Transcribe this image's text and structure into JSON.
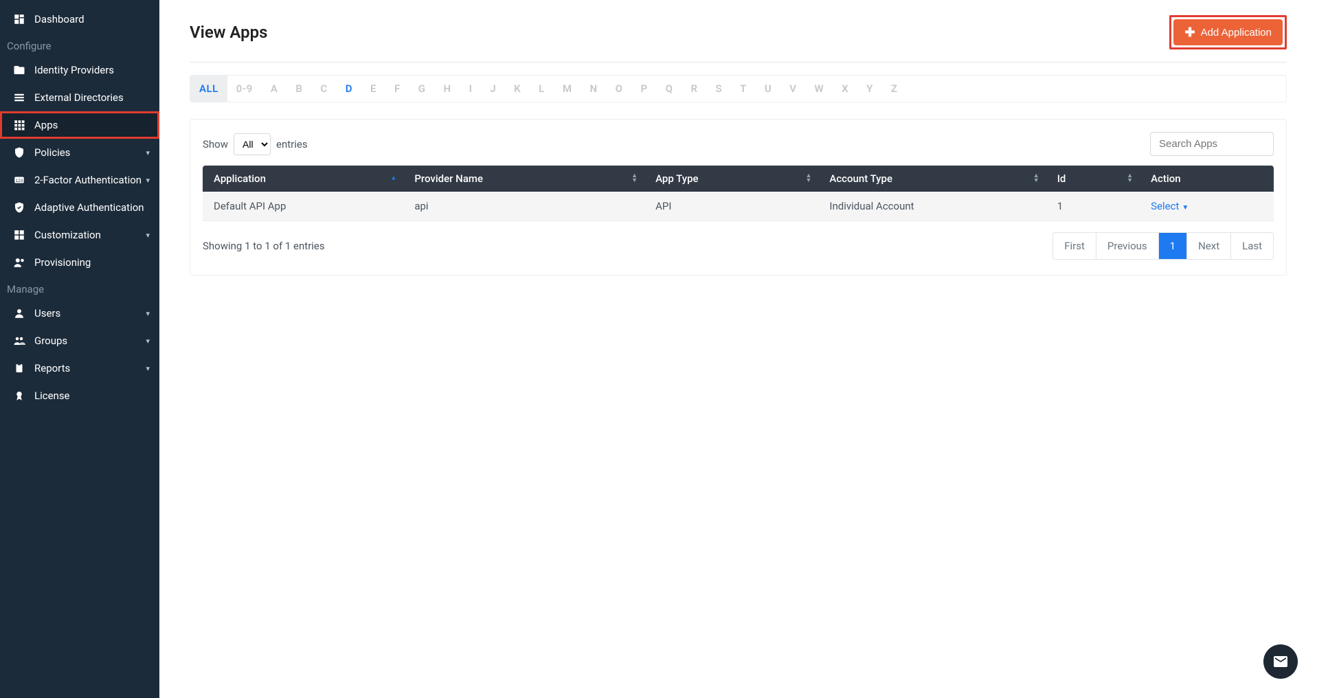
{
  "sidebar": {
    "items": [
      {
        "label": "Dashboard",
        "icon": "dashboard-icon",
        "chev": false
      },
      {
        "section": "Configure"
      },
      {
        "label": "Identity Providers",
        "icon": "idp-icon",
        "chev": false
      },
      {
        "label": "External Directories",
        "icon": "list-icon",
        "chev": false
      },
      {
        "label": "Apps",
        "icon": "grid-icon",
        "chev": false,
        "active": true,
        "highlight": true
      },
      {
        "label": "Policies",
        "icon": "shield-icon",
        "chev": true
      },
      {
        "label": "2-Factor Authentication",
        "icon": "numbers-icon",
        "chev": true
      },
      {
        "label": "Adaptive Authentication",
        "icon": "check-shield-icon",
        "chev": false
      },
      {
        "label": "Customization",
        "icon": "puzzle-icon",
        "chev": true
      },
      {
        "label": "Provisioning",
        "icon": "users-cog-icon",
        "chev": false
      },
      {
        "section": "Manage"
      },
      {
        "label": "Users",
        "icon": "user-icon",
        "chev": true
      },
      {
        "label": "Groups",
        "icon": "group-icon",
        "chev": true
      },
      {
        "label": "Reports",
        "icon": "clipboard-icon",
        "chev": true
      },
      {
        "label": "License",
        "icon": "ribbon-icon",
        "chev": false
      }
    ]
  },
  "header": {
    "title": "View Apps",
    "add_label": "Add Application"
  },
  "alpha": {
    "items": [
      "ALL",
      "0-9",
      "A",
      "B",
      "C",
      "D",
      "E",
      "F",
      "G",
      "H",
      "I",
      "J",
      "K",
      "L",
      "M",
      "N",
      "O",
      "P",
      "Q",
      "R",
      "S",
      "T",
      "U",
      "V",
      "W",
      "X",
      "Y",
      "Z"
    ],
    "active": "ALL",
    "lit": [
      "D"
    ]
  },
  "table": {
    "show_label_pre": "Show",
    "show_value": "All",
    "show_label_post": "entries",
    "search_placeholder": "Search Apps",
    "columns": [
      "Application",
      "Provider Name",
      "App Type",
      "Account Type",
      "Id",
      "Action"
    ],
    "rows": [
      {
        "application": "Default API App",
        "provider": "api",
        "apptype": "API",
        "account": "Individual Account",
        "id": "1",
        "action": "Select"
      }
    ],
    "info": "Showing 1 to 1 of 1 entries",
    "pagination": [
      "First",
      "Previous",
      "1",
      "Next",
      "Last"
    ],
    "page_active": "1"
  }
}
